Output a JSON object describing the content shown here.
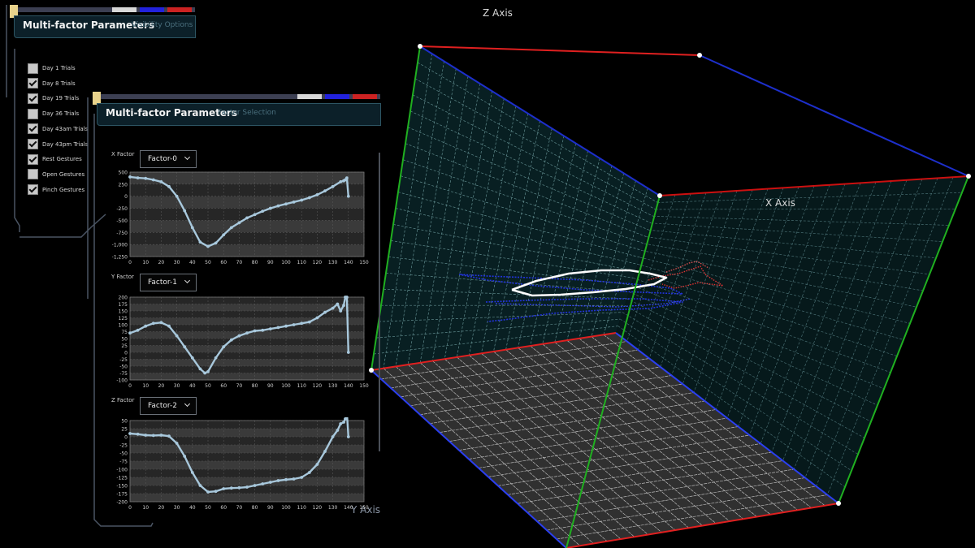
{
  "scene": {
    "axis_labels": {
      "z": "Z Axis",
      "x": "X Axis",
      "y": "Y Axis"
    }
  },
  "visibility_panel": {
    "title": "Multi-factor Parameters",
    "subtitle": "Visibility Options",
    "colors": {
      "bar": "#3c3f52",
      "seg1": "#d8d8d8",
      "seg2": "#2222dd",
      "seg3": "#cc2222"
    },
    "options": [
      {
        "label": "Day 1 Trials",
        "checked": false
      },
      {
        "label": "Day 8 Trials",
        "checked": true
      },
      {
        "label": "Day 19 Trials",
        "checked": true
      },
      {
        "label": "Day 36 Trials",
        "checked": false
      },
      {
        "label": "Day 43am Trials",
        "checked": true
      },
      {
        "label": "Day 43pm Trials",
        "checked": true
      },
      {
        "label": "Rest Gestures",
        "checked": true
      },
      {
        "label": "Open Gestures",
        "checked": false
      },
      {
        "label": "Pinch Gestures",
        "checked": true
      }
    ]
  },
  "factor_panel": {
    "title": "Multi-factor Parameters",
    "subtitle": "Factor Selection",
    "factors": [
      {
        "label": "X Factor",
        "selected": "Factor-0"
      },
      {
        "label": "Y Factor",
        "selected": "Factor-1"
      },
      {
        "label": "Z Factor",
        "selected": "Factor-2"
      }
    ]
  },
  "chart_data": [
    {
      "type": "line",
      "title": "",
      "x": [
        0,
        5,
        10,
        15,
        20,
        25,
        30,
        35,
        40,
        45,
        50,
        55,
        60,
        65,
        70,
        75,
        80,
        85,
        90,
        95,
        100,
        105,
        110,
        115,
        120,
        125,
        130,
        135,
        137,
        138,
        139,
        140
      ],
      "series": [
        {
          "values": [
            400,
            380,
            370,
            340,
            300,
            200,
            0,
            -300,
            -650,
            -950,
            -1040,
            -970,
            -800,
            -650,
            -550,
            -450,
            -380,
            -310,
            -250,
            -200,
            -160,
            -120,
            -80,
            -30,
            30,
            110,
            200,
            300,
            320,
            340,
            380,
            0
          ]
        }
      ],
      "xlim": [
        0,
        150
      ],
      "ylim": [
        -1250,
        500
      ],
      "xticks": [
        0,
        10,
        20,
        30,
        40,
        50,
        60,
        70,
        80,
        90,
        100,
        110,
        120,
        130,
        140,
        150
      ],
      "yticks": [
        500,
        250,
        0,
        -250,
        -500,
        -750,
        -1000,
        -1250
      ],
      "ytick_labels": [
        "500",
        "250",
        "0",
        "-250",
        "-500",
        "-750",
        "-1,000",
        "-1,250"
      ],
      "color": "#a8c8dc"
    },
    {
      "type": "line",
      "title": "",
      "x": [
        0,
        5,
        10,
        15,
        20,
        25,
        30,
        35,
        40,
        45,
        48,
        50,
        55,
        60,
        65,
        70,
        75,
        80,
        85,
        90,
        95,
        100,
        105,
        110,
        115,
        120,
        125,
        130,
        133,
        135,
        137,
        138,
        139,
        140
      ],
      "series": [
        {
          "values": [
            70,
            80,
            95,
            105,
            108,
            95,
            60,
            20,
            -20,
            -60,
            -75,
            -70,
            -20,
            20,
            45,
            60,
            70,
            78,
            80,
            85,
            90,
            95,
            100,
            105,
            110,
            125,
            145,
            160,
            175,
            150,
            170,
            200,
            200,
            0
          ]
        }
      ],
      "xlim": [
        0,
        150
      ],
      "ylim": [
        -100,
        200
      ],
      "xticks": [
        0,
        10,
        20,
        30,
        40,
        50,
        60,
        70,
        80,
        90,
        100,
        110,
        120,
        130,
        140,
        150
      ],
      "yticks": [
        200,
        175,
        150,
        125,
        100,
        75,
        50,
        25,
        0,
        -25,
        -50,
        -75,
        -100
      ],
      "color": "#a8c8dc"
    },
    {
      "type": "line",
      "title": "",
      "x": [
        0,
        5,
        10,
        15,
        20,
        25,
        30,
        35,
        40,
        45,
        50,
        55,
        60,
        65,
        70,
        75,
        80,
        85,
        90,
        95,
        100,
        105,
        110,
        115,
        120,
        125,
        130,
        133,
        135,
        137,
        138,
        139,
        140
      ],
      "series": [
        {
          "values": [
            10,
            8,
            5,
            4,
            5,
            2,
            -20,
            -60,
            -110,
            -150,
            -170,
            -168,
            -160,
            -158,
            -157,
            -155,
            -150,
            -145,
            -140,
            -135,
            -132,
            -130,
            -125,
            -110,
            -85,
            -45,
            0,
            20,
            40,
            45,
            55,
            75,
            0
          ]
        }
      ],
      "xlim": [
        0,
        150
      ],
      "ylim": [
        -200,
        50
      ],
      "xticks": [
        0,
        10,
        20,
        30,
        40,
        50,
        60,
        70,
        80,
        90,
        100,
        110,
        120,
        130,
        140,
        150
      ],
      "yticks": [
        50,
        25,
        0,
        -25,
        -50,
        -75,
        -100,
        -125,
        -150,
        -175,
        -200
      ],
      "color": "#a8c8dc"
    }
  ]
}
